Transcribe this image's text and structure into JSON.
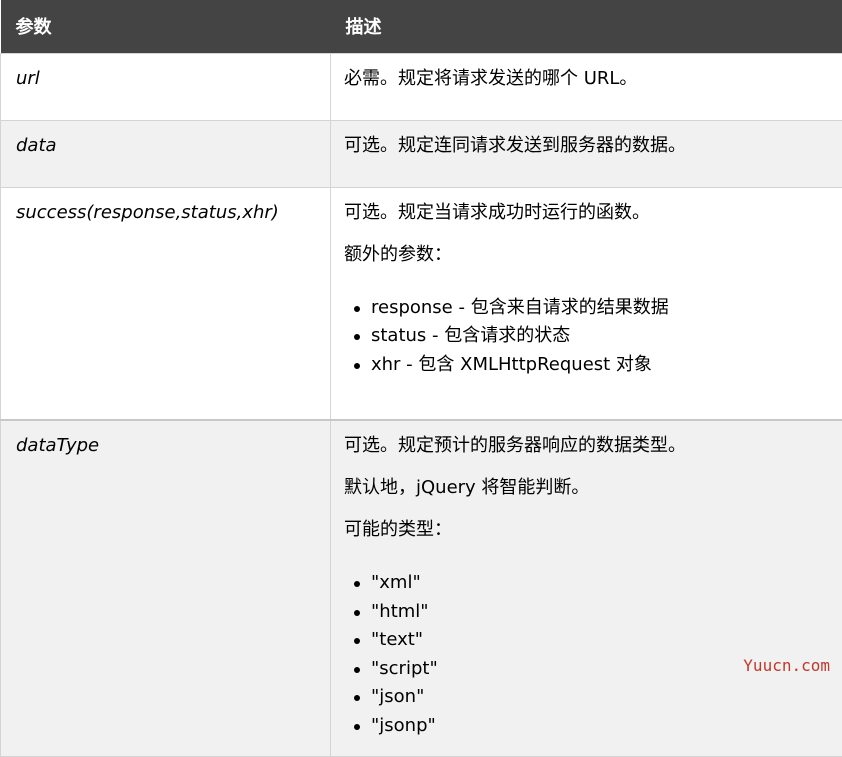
{
  "header": {
    "col_param": "参数",
    "col_desc": "描述"
  },
  "rows": [
    {
      "param": "url",
      "paragraphs": [
        "必需。规定将请求发送的哪个 URL。"
      ],
      "bullets": []
    },
    {
      "param": "data",
      "paragraphs": [
        "可选。规定连同请求发送到服务器的数据。"
      ],
      "bullets": []
    },
    {
      "param": "success(response,status,xhr)",
      "paragraphs": [
        "可选。规定当请求成功时运行的函数。",
        "额外的参数："
      ],
      "bullets": [
        "response - 包含来自请求的结果数据",
        "status - 包含请求的状态",
        "xhr - 包含 XMLHttpRequest 对象"
      ]
    },
    {
      "param": "dataType",
      "paragraphs": [
        "可选。规定预计的服务器响应的数据类型。",
        "默认地，jQuery 将智能判断。",
        "可能的类型："
      ],
      "bullets": [
        "\"xml\"",
        "\"html\"",
        "\"text\"",
        "\"script\"",
        "\"json\"",
        "\"jsonp\""
      ]
    }
  ],
  "watermark": "Yuucn.com"
}
